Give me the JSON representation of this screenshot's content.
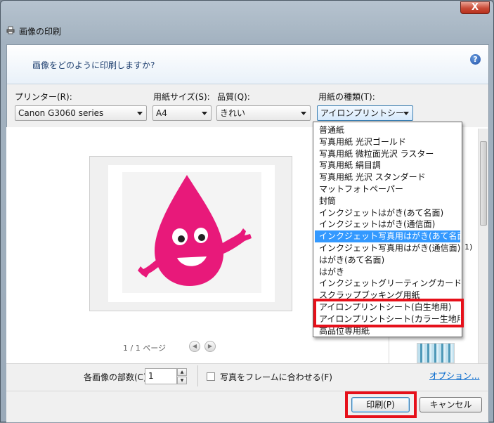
{
  "window": {
    "title": "画像の印刷",
    "close_label": "X"
  },
  "question": "画像をどのように印刷しますか?",
  "printer": {
    "label": "プリンター(R):",
    "value": "Canon G3060 series"
  },
  "paper_size": {
    "label": "用紙サイズ(S):",
    "value": "A4"
  },
  "quality": {
    "label": "品質(Q):",
    "value": "きれい"
  },
  "paper_type": {
    "label": "用紙の種類(T):",
    "value": "アイロンプリントシー",
    "options": [
      "普通紙",
      "写真用紙 光沢ゴールド",
      "写真用紙 微粒面光沢 ラスター",
      "写真用紙 絹目調",
      "写真用紙 光沢 スタンダード",
      "マットフォトペーパー",
      "封筒",
      "インクジェットはがき(あて名面)",
      "インクジェットはがき(通信面)",
      "インクジェット写真用はがき(あて名面)",
      "インクジェット写真用はがき(通信面)",
      "はがき(あて名面)",
      "はがき",
      "インクジェットグリーティングカード",
      "スクラップブッキング用紙",
      "アイロンプリントシート(白生地用)",
      "アイロンプリントシート(カラー生地用)",
      "高品位専用紙"
    ],
    "selected_index": 9
  },
  "preview": {
    "page_indicator": "1 / 1 ページ",
    "prev_icon": "◀",
    "next_icon": "▶"
  },
  "peek": {
    "layout_text": "1)"
  },
  "copies": {
    "label": "各画像の部数(C):",
    "value": "1",
    "up": "▲",
    "down": "▼"
  },
  "fit_frame": {
    "label": "写真をフレームに合わせる(F)"
  },
  "options_link": "オプション...",
  "buttons": {
    "print": "印刷(P)",
    "cancel": "キャンセル"
  },
  "help_icon_glyph": "?",
  "colors": {
    "highlight": "#3399ff",
    "annotation_red": "#e6101a",
    "mascot_pink": "#e8197a"
  }
}
